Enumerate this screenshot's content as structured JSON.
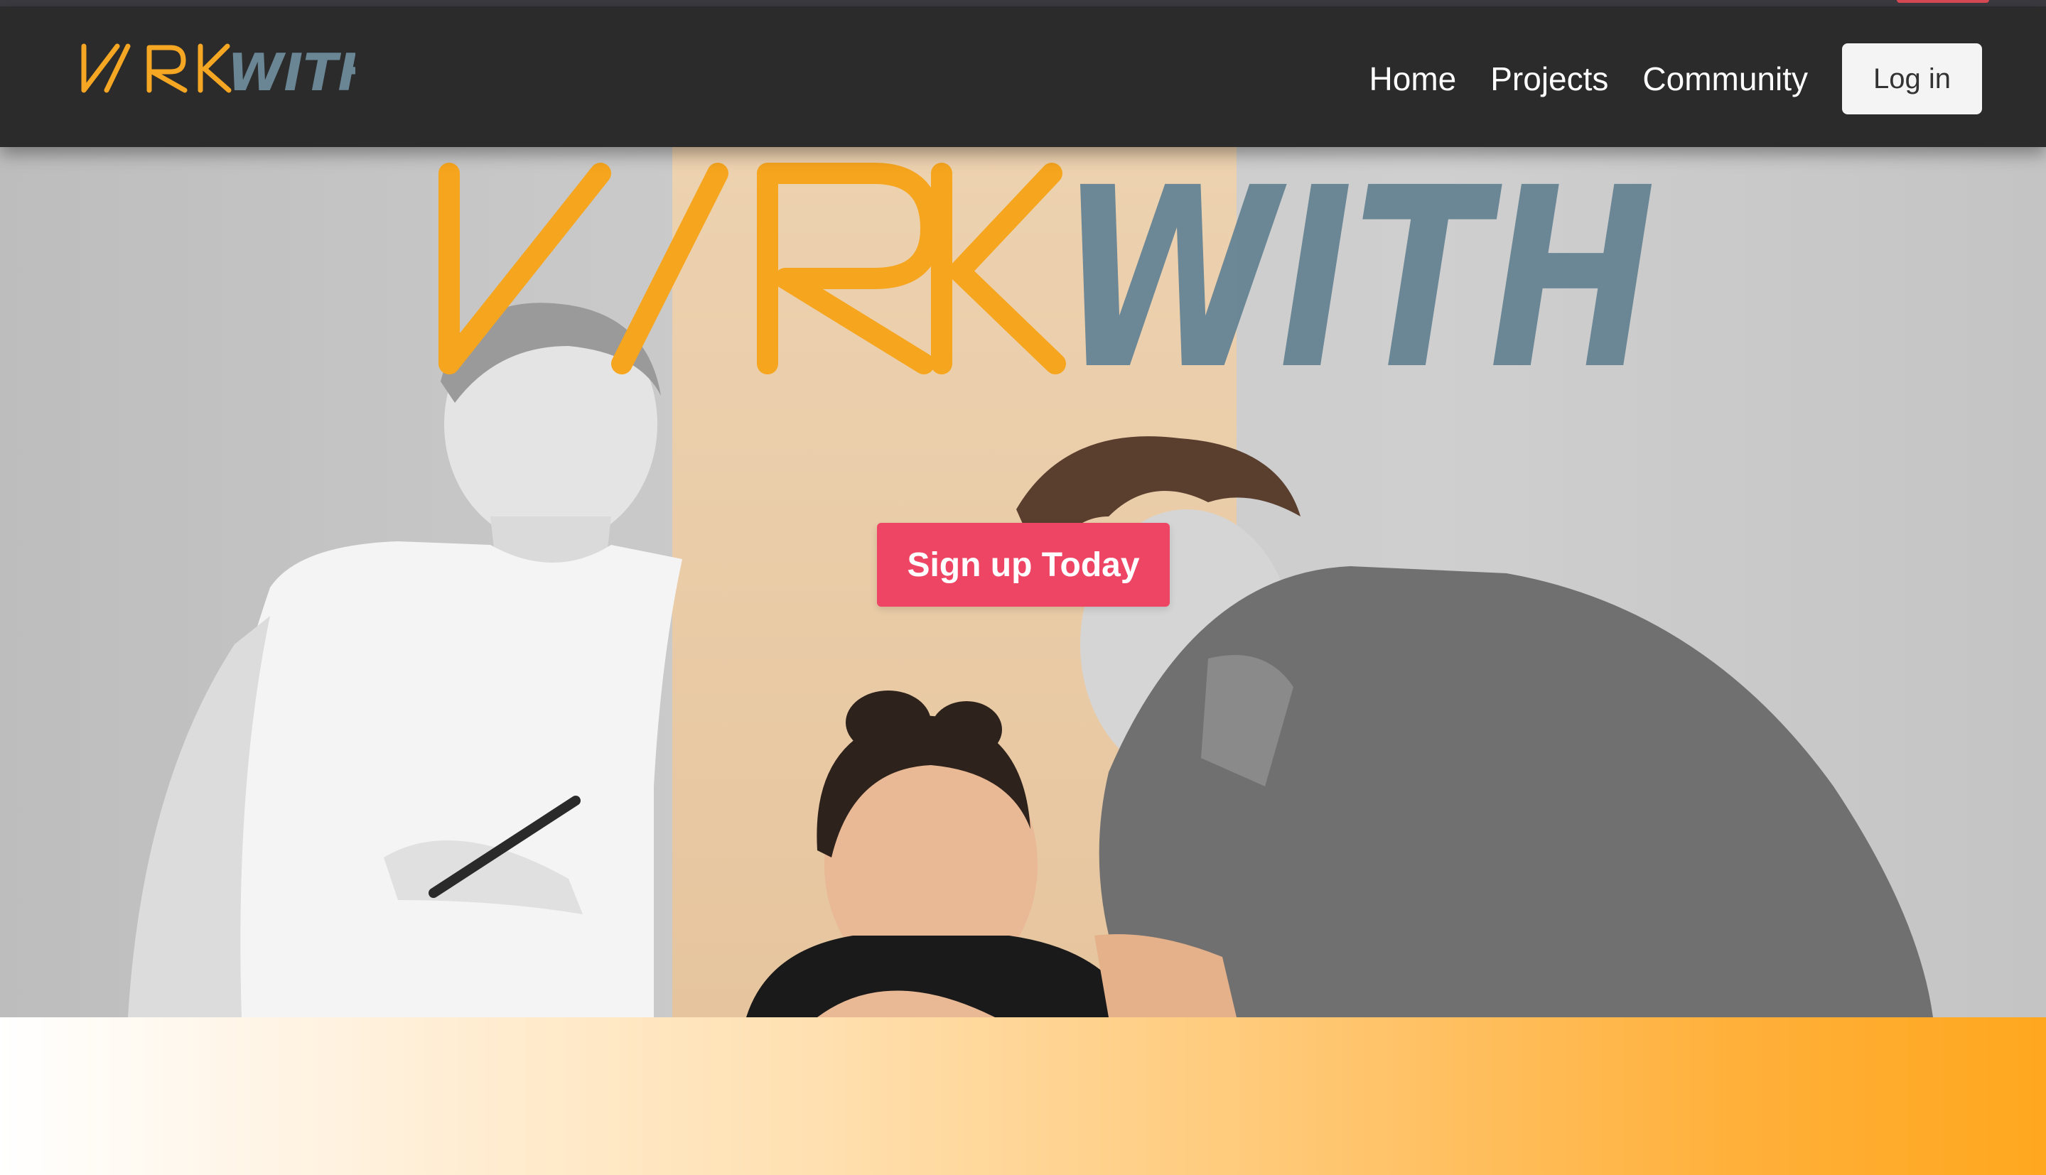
{
  "brand": {
    "logo_text_part1": "WRK",
    "logo_text_part2": "WITH",
    "logo_orange": "#f5a623",
    "logo_slate": "#6a8695"
  },
  "nav": {
    "links": [
      {
        "label": "Home"
      },
      {
        "label": "Projects"
      },
      {
        "label": "Community"
      }
    ],
    "login_label": "Log in"
  },
  "hero": {
    "cta_label": "Sign up Today",
    "cta_color": "#ee4565",
    "band_color": "#edd2b0",
    "illustration": "three people collaborating at a desk"
  },
  "footer_band": {
    "gradient_end_color": "#ffa71e"
  }
}
